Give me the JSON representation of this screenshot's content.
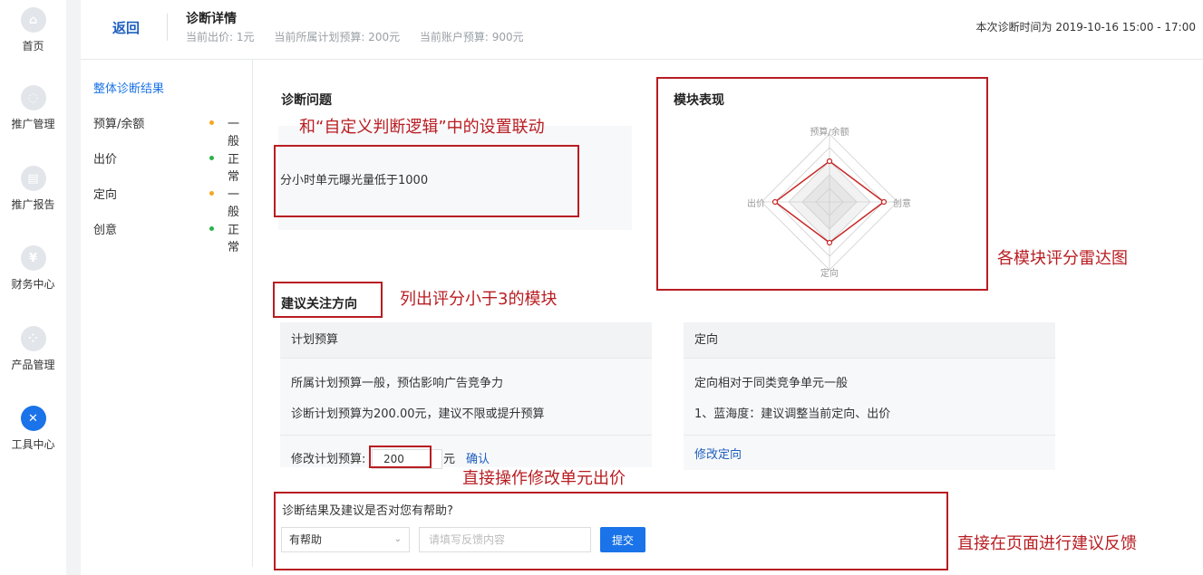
{
  "sidebar": {
    "items": [
      {
        "label": "首页",
        "icon": "home-icon",
        "glyph": "⌂"
      },
      {
        "label": "推广管理",
        "icon": "promotion-icon",
        "glyph": "◌"
      },
      {
        "label": "推广报告",
        "icon": "report-icon",
        "glyph": "▤"
      },
      {
        "label": "财务中心",
        "icon": "finance-icon",
        "glyph": "¥"
      },
      {
        "label": "产品管理",
        "icon": "product-icon",
        "glyph": "⁘"
      },
      {
        "label": "工具中心",
        "icon": "tools-icon",
        "glyph": "✕"
      }
    ]
  },
  "header": {
    "back_label": "返回",
    "title": "诊断详情",
    "subtitle": [
      "当前出价: 1元",
      "当前所属计划预算: 200元",
      "当前账户预算: 900元"
    ],
    "time_text": "本次诊断时间为 2019-10-16 15:00 - 17:00"
  },
  "nav": {
    "head": "整体诊断结果",
    "rows": [
      {
        "label": "预算/余额",
        "status": "一般",
        "dot_color": "#f5a623"
      },
      {
        "label": "出价",
        "status": "正常",
        "dot_color": "#2bb24c"
      },
      {
        "label": "定向",
        "status": "一般",
        "dot_color": "#f5a623"
      },
      {
        "label": "创意",
        "status": "正常",
        "dot_color": "#2bb24c"
      }
    ]
  },
  "diagnosis": {
    "title": "诊断问题",
    "text": "分小时单元曝光量低于1000"
  },
  "module": {
    "title": "模块表现",
    "axes": [
      "预算/余额",
      "创意",
      "定向",
      "出价"
    ],
    "scores": [
      3,
      4,
      3,
      4
    ],
    "max": 5
  },
  "suggest": {
    "title": "建议关注方向",
    "cards": [
      {
        "head": "计划预算",
        "lines": [
          "所属计划预算一般，预估影响广告竞争力",
          "诊断计划预算为200.00元，建议不限或提升预算"
        ],
        "input_label": "修改计划预算:",
        "input_value": "200",
        "unit": "元",
        "confirm": "确认"
      },
      {
        "head": "定向",
        "lines": [
          "定向相对于同类竞争单元一般",
          "1、蓝海度：建议调整当前定向、出价"
        ],
        "link": "修改定向"
      }
    ]
  },
  "feedback": {
    "question": "诊断结果及建议是否对您有帮助?",
    "select_value": "有帮助",
    "input_placeholder": "请填写反馈内容",
    "submit": "提交"
  },
  "annotations": {
    "a1": "和“自定义判断逻辑”中的设置联动",
    "a2": "各模块评分雷达图",
    "a3": "列出评分小于3的模块",
    "a4": "直接操作修改单元出价",
    "a5": "直接在页面进行建议反馈"
  },
  "colors": {
    "accent": "#1a73e8",
    "annotation": "#b81d22"
  }
}
